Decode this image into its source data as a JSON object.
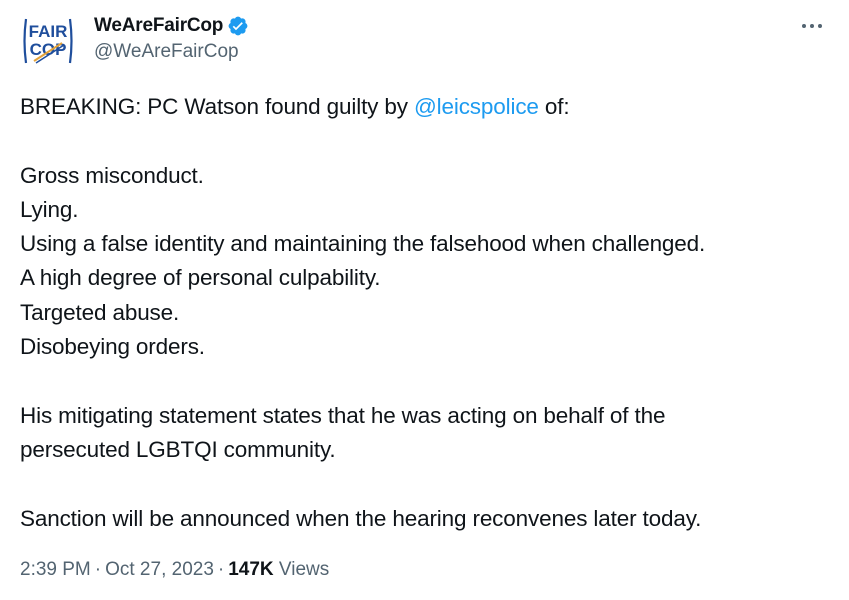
{
  "author": {
    "display_name": "WeAreFairCop",
    "handle": "@WeAreFairCop",
    "verified": true,
    "avatar_icon": "fair-cop-logo-icon",
    "avatar_text_line1": "FAIR",
    "avatar_text_line2": "COP",
    "verified_color": "#1d9bf0"
  },
  "menu": {
    "icon": "more-horizontal-icon"
  },
  "tweet": {
    "line1_prefix": "BREAKING: PC Watson found guilty by ",
    "mention": "@leicspolice",
    "line1_suffix": " of:",
    "list": [
      "Gross misconduct.",
      "Lying.",
      "Using a false identity and maintaining the falsehood when challenged.",
      "A high degree of personal culpability.",
      "Targeted abuse.",
      "Disobeying orders."
    ],
    "para2_line1": "His mitigating statement states that he was acting on behalf of the",
    "para2_line2": "persecuted LGBTQI community.",
    "para3": "Sanction will be announced when the hearing reconvenes later today."
  },
  "meta": {
    "time": "2:39 PM",
    "separator": "·",
    "date": "Oct 27, 2023",
    "views_count": "147K",
    "views_label": "Views"
  },
  "colors": {
    "text": "#0f1419",
    "secondary": "#536471",
    "accent": "#1d9bf0",
    "logo_blue": "#1f4e9c"
  }
}
